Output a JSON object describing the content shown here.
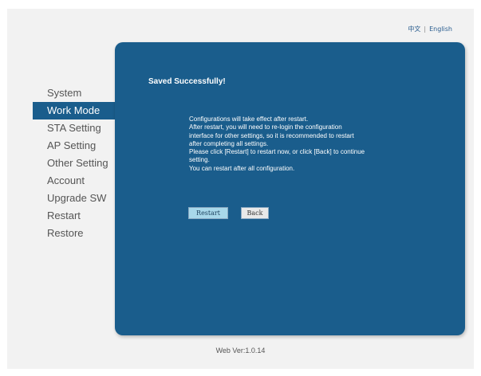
{
  "language": {
    "chinese": "中文",
    "separator": "|",
    "english": "English"
  },
  "sidebar": {
    "items": [
      {
        "label": "System"
      },
      {
        "label": "Work Mode"
      },
      {
        "label": "STA Setting"
      },
      {
        "label": "AP Setting"
      },
      {
        "label": "Other Setting"
      },
      {
        "label": "Account"
      },
      {
        "label": "Upgrade SW"
      },
      {
        "label": "Restart"
      },
      {
        "label": "Restore"
      }
    ],
    "active_index": 1
  },
  "main": {
    "title": "Saved Successfully!",
    "message_lines": [
      "Configurations will take effect after restart.",
      "After restart, you will need to re-login the configuration",
      "interface for other settings, so it is recommended to restart",
      "after completing all settings.",
      "Please click [Restart] to restart now, or click [Back] to continue",
      "setting.",
      "You can restart after all configuration."
    ],
    "restart_button": "Restart",
    "back_button": "Back"
  },
  "footer": {
    "version": "Web Ver:1.0.14"
  },
  "colors": {
    "panel": "#1a5d8c",
    "active_item": "#1a5d8c",
    "restart_button": "#a8d8ea"
  }
}
